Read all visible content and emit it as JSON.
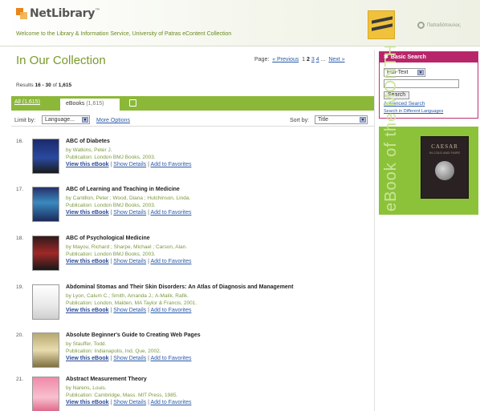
{
  "header": {
    "logo_text": "NetLibrary",
    "logo_tm": "™",
    "welcome": "Welcome to the Library & Information Service, University of Patras eContent Collection",
    "partner_text": "Παπαδόπουλος"
  },
  "main": {
    "title": "In Our Collection",
    "pager": {
      "label": "Page:",
      "prev": "« Previous",
      "pages": [
        "1",
        "2",
        "3",
        "4"
      ],
      "current": "2",
      "ellipsis": "...",
      "next": "Next »"
    },
    "results": {
      "prefix": "Results",
      "range": "16 - 30",
      "of": "of",
      "total": "1,615"
    },
    "tabs": {
      "all_label": "All",
      "all_count": "(1,615)",
      "ebooks_label": "eBooks",
      "ebooks_count": "(1,615)"
    },
    "filters": {
      "limit_label": "Limit by:",
      "limit_value": "Language...",
      "more_options": "More Options",
      "sort_label": "Sort by:",
      "sort_value": "Title"
    },
    "items": [
      {
        "num": "16.",
        "title": "ABC of Diabetes",
        "by": "by Watkins, Peter J.",
        "pub": "Publication: London BMJ Books, 2003.",
        "view": "View this eBook",
        "details": "Show Details",
        "fav": "Add to Favorites"
      },
      {
        "num": "17.",
        "title": "ABC of Learning and Teaching in Medicine",
        "by": "by Cantillon, Peter ; Wood, Diana ; Hutchinson, Linda.",
        "pub": "Publication: London BMJ Books, 2003.",
        "view": "View this eBook",
        "details": "Show Details",
        "fav": "Add to Favorites"
      },
      {
        "num": "18.",
        "title": "ABC of Psychological Medicine",
        "by": "by Mayou, Richard ; Sharpe, Michael ; Carson, Alan.",
        "pub": "Publication: London BMJ Books, 2003.",
        "view": "View this eBook",
        "details": "Show Details",
        "fav": "Add to Favorites"
      },
      {
        "num": "19.",
        "title": "Abdominal Stomas and Their Skin Disorders: An Atlas of Diagnosis and Management",
        "by": "by Lyon, Calum C.; Smith, Amanda J.; A-Malik, Rafik.",
        "pub": "Publication: London, Malden, MA Taylor & Francis, 2001.",
        "view": "View this eBook",
        "details": "Show Details",
        "fav": "Add to Favorites"
      },
      {
        "num": "20.",
        "title": "Absolute Beginner's Guide to Creating Web Pages",
        "by": "by Stauffer, Todd.",
        "pub": "Publication: Indianapolis, Ind. Que, 2002.",
        "view": "View this eBook",
        "details": "Show Details",
        "fav": "Add to Favorites"
      },
      {
        "num": "21.",
        "title": "Abstract Measurement Theory",
        "by": "by Narens, Louis.",
        "pub": "Publication: Cambridge, Mass. MIT Press, 1985.",
        "view": "View this eBook",
        "details": "Show Details",
        "fav": "Add to Favorites"
      }
    ],
    "separator": "|"
  },
  "sidebar": {
    "search_title": "Basic Search",
    "search_type": "Full-Text",
    "search_value": "",
    "search_button": "Search",
    "advanced": "Advanced Search",
    "languages": "Search in Different Languages",
    "eotm_text": "eBook of the MONTH",
    "book_title": "CAESAR",
    "book_subtitle": "IN COLD AND FAIRE"
  },
  "colors": {
    "brand_green": "#8cb83a",
    "title_green": "#7a9a2a",
    "search_magenta": "#b8266a",
    "link_blue": "#2a5aa8"
  }
}
